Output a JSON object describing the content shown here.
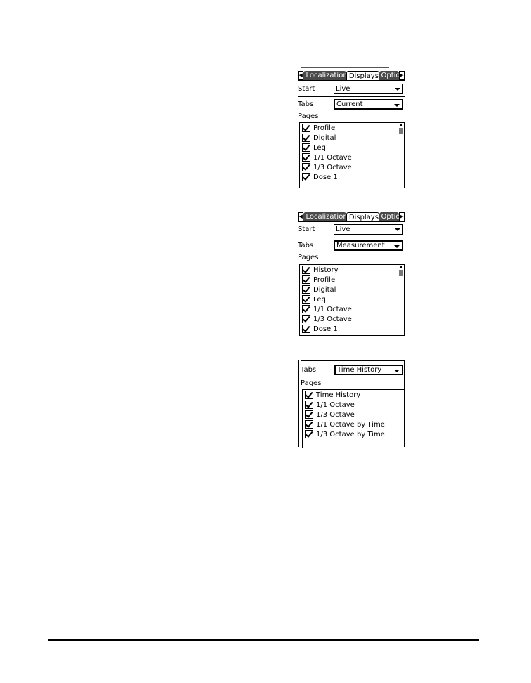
{
  "panels": [
    {
      "tabs": {
        "scroll_left": "◀",
        "items": [
          "Localization",
          "Displays",
          "Optio"
        ],
        "active": "Displays",
        "scroll_right": "▶"
      },
      "start": {
        "label": "Start",
        "value": "Live"
      },
      "tabs_field": {
        "label": "Tabs",
        "value": "Current"
      },
      "pages": {
        "label": "Pages",
        "items": [
          {
            "label": "Profile",
            "checked": true
          },
          {
            "label": "Digital",
            "checked": true
          },
          {
            "label": "Leq",
            "checked": true
          },
          {
            "label": "1/1 Octave",
            "checked": true
          },
          {
            "label": "1/3 Octave",
            "checked": true
          },
          {
            "label": "Dose 1",
            "checked": true
          }
        ]
      }
    },
    {
      "tabs": {
        "scroll_left": "◀",
        "items": [
          "Localization",
          "Displays",
          "Optio"
        ],
        "active": "Displays",
        "scroll_right": "▶"
      },
      "start": {
        "label": "Start",
        "value": "Live"
      },
      "tabs_field": {
        "label": "Tabs",
        "value": "Measurement"
      },
      "pages": {
        "label": "Pages",
        "items": [
          {
            "label": "History",
            "checked": true
          },
          {
            "label": "Profile",
            "checked": true
          },
          {
            "label": "Digital",
            "checked": true
          },
          {
            "label": "Leq",
            "checked": true
          },
          {
            "label": "1/1 Octave",
            "checked": true
          },
          {
            "label": "1/3 Octave",
            "checked": true
          },
          {
            "label": "Dose 1",
            "checked": true
          }
        ]
      }
    },
    {
      "tabs_field": {
        "label": "Tabs",
        "value": "Time History"
      },
      "pages": {
        "label": "Pages",
        "items": [
          {
            "label": "Time History",
            "checked": true
          },
          {
            "label": "1/1 Octave",
            "checked": true
          },
          {
            "label": "1/3 Octave",
            "checked": true
          },
          {
            "label": "1/1 Octave by Time",
            "checked": true
          },
          {
            "label": "1/3 Octave by Time",
            "checked": true
          }
        ]
      }
    }
  ]
}
